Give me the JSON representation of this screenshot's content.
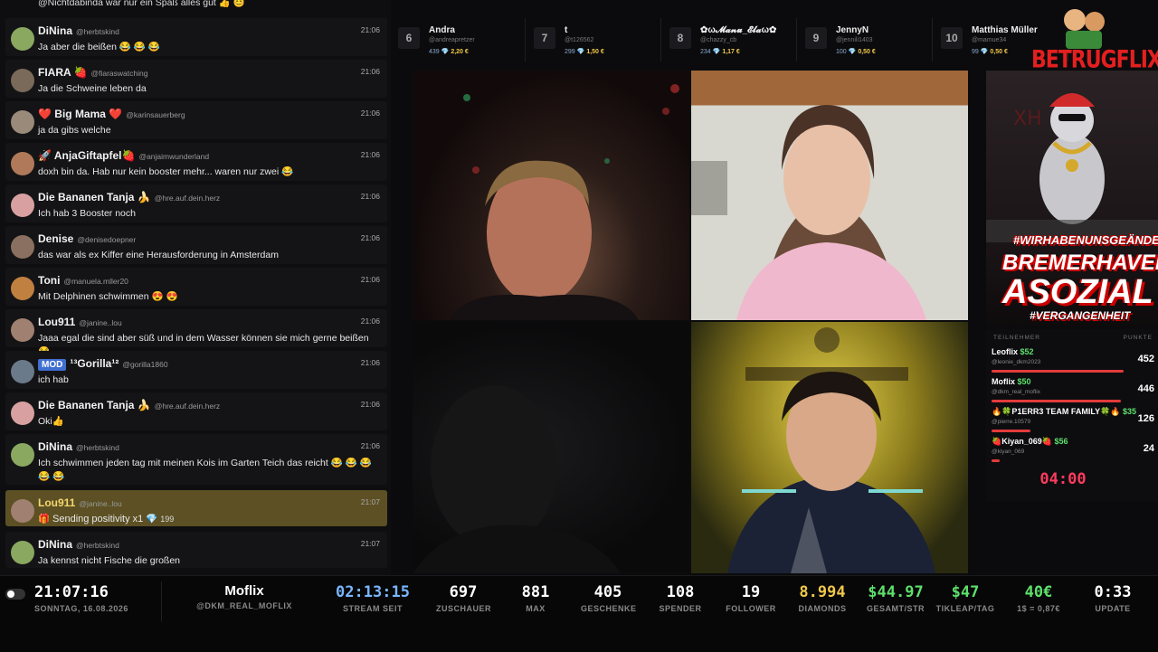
{
  "chat": {
    "top_partial": "@Nichtdabinda war nur ein Spaß alles gut 👍 😊",
    "messages": [
      {
        "name": "DiNina",
        "handle": "@herbtskind",
        "time": "21:06",
        "text": "Ja aber die beißen 😂 😂 😂",
        "avatar_color": "#8aa860"
      },
      {
        "name": "FIARA 🍓",
        "handle": "@fiaraswatching",
        "time": "21:06",
        "text": "Ja die Schweine leben da",
        "avatar_color": "#7a6a5a"
      },
      {
        "name": "❤️ Big Mama ❤️",
        "handle": "@karinsauerberg",
        "time": "21:06",
        "text": "ja da gibs welche",
        "avatar_color": "#9a8a7a"
      },
      {
        "name": "🚀 AnjaGiftapfel🍓",
        "handle": "@anjaimwunderland",
        "time": "21:06",
        "text": "doxh bin da. Hab nur kein booster mehr... waren nur zwei 😂",
        "avatar_color": "#b07a5a"
      },
      {
        "name": "Die Bananen Tanja 🍌",
        "handle": "@hre.auf.dein.herz",
        "time": "21:06",
        "text": "Ich hab 3 Booster noch",
        "avatar_color": "#d8a0a0"
      },
      {
        "name": "Denise",
        "handle": "@denisedoepner",
        "time": "21:06",
        "text": "das war als ex Kiffer eine Herausforderung in Amsterdam",
        "avatar_color": "#8a7060"
      },
      {
        "name": "Toni",
        "handle": "@manuela.mller20",
        "time": "21:06",
        "text": "Mit Delphinen schwimmen 😍 😍",
        "avatar_color": "#c08040"
      },
      {
        "name": "Lou911",
        "handle": "@janine..lou",
        "time": "21:06",
        "text": "Jaaa egal die sind aber süß und in dem Wasser können sie mich gerne beißen 😂",
        "avatar_color": "#a08070"
      },
      {
        "name": "¹³Gorilla¹²",
        "handle": "@gorilla1860",
        "time": "21:06",
        "text": "ich hab",
        "avatar_color": "#6a7a8a",
        "badge": "MOD"
      },
      {
        "name": "Die Bananen Tanja 🍌",
        "handle": "@hre.auf.dein.herz",
        "time": "21:06",
        "text": "Oki👍",
        "avatar_color": "#d8a0a0"
      },
      {
        "name": "DiNina",
        "handle": "@herbtskind",
        "time": "21:06",
        "text": "Ich schwimmen jeden tag mit meinen Kois im Garten Teich das reicht 😂 😂 😂 😂 😂",
        "avatar_color": "#8aa860"
      },
      {
        "name": "Lou911",
        "handle": "@janine..lou",
        "time": "21:07",
        "text": "Sending positivity x1",
        "gift_value": "199",
        "avatar_color": "#a08070",
        "highlight": true
      },
      {
        "name": "DiNina",
        "handle": "@herbtskind",
        "time": "21:07",
        "text": "Ja kennst nicht Fische die großen",
        "avatar_color": "#8aa860"
      }
    ]
  },
  "ranking": [
    {
      "num": "6",
      "name": "Andra",
      "handle": "@andreapretzer",
      "count": "439",
      "amount": "2,20 €"
    },
    {
      "num": "7",
      "name": "t",
      "handle": "@t126562",
      "count": "299",
      "amount": "1,50 €"
    },
    {
      "num": "8",
      "name": "✿ω𝓜𝓪𝓷𝓾_𝓔𝓵𝓪ω✿",
      "handle": "@chazzy_cb",
      "count": "234",
      "amount": "1,17 €"
    },
    {
      "num": "9",
      "name": "JennyN",
      "handle": "@jennili1403",
      "count": "100",
      "amount": "0,50 €"
    },
    {
      "num": "10",
      "name": "Matthias Müller",
      "handle": "@mamue34",
      "count": "99",
      "amount": "0,50 €"
    }
  ],
  "sidebar": {
    "brand": "BETRUGFLIX",
    "hashtag1": "#WIRHABENUNSGEÄNDERT",
    "title1": "BREMERHAVEN",
    "title2": "ASOZIAL",
    "hashtag2": "#VERGANGENHEIT",
    "board_left": "TEILNEHMER",
    "board_right": "PUNKTE",
    "players": [
      {
        "name": "Leoflix",
        "value": "$52",
        "handle": "@leonie_dkm2023",
        "points": "452",
        "fill": 0.95
      },
      {
        "name": "Moflix",
        "value": "$50",
        "handle": "@dkm_real_moflix",
        "points": "446",
        "fill": 0.93
      },
      {
        "name": "🔥🍀P1ERR3 TEAM FAMILY🍀🔥",
        "value": "$35",
        "handle": "@pierre.10579",
        "points": "126",
        "fill": 0.28
      },
      {
        "name": "🍓Kiyan_069🍓",
        "value": "$56",
        "handle": "@kiyan_069",
        "points": "24",
        "fill": 0.06
      }
    ],
    "timer": "04:00"
  },
  "bottom": {
    "clock": "21:07:16",
    "date": "SONNTAG, 16.08.2026",
    "streamer": "Moflix",
    "streamer_handle": "@DKM_REAL_MOFLIX",
    "stats": [
      {
        "value": "02:13:15",
        "label": "STREAM SEIT",
        "color": "#7ab6ff"
      },
      {
        "value": "697",
        "label": "ZUSCHAUER",
        "color": "#ffffff"
      },
      {
        "value": "881",
        "label": "MAX",
        "color": "#ffffff"
      },
      {
        "value": "405",
        "label": "GESCHENKE",
        "color": "#ffffff"
      },
      {
        "value": "108",
        "label": "SPENDER",
        "color": "#ffffff"
      },
      {
        "value": "19",
        "label": "FOLLOWER",
        "color": "#ffffff"
      },
      {
        "value": "8.994",
        "label": "DIAMONDS",
        "color": "#f0c84a"
      },
      {
        "value": "$44.97",
        "label": "GESAMT/STR",
        "color": "#5ee06b"
      },
      {
        "value": "$47",
        "label": "TIKLEAP/TAG",
        "color": "#5ee06b"
      },
      {
        "value": "40€",
        "label": "1$ = 0,87€",
        "color": "#5ee06b"
      },
      {
        "value": "0:33",
        "label": "UPDATE",
        "color": "#ffffff"
      }
    ]
  }
}
